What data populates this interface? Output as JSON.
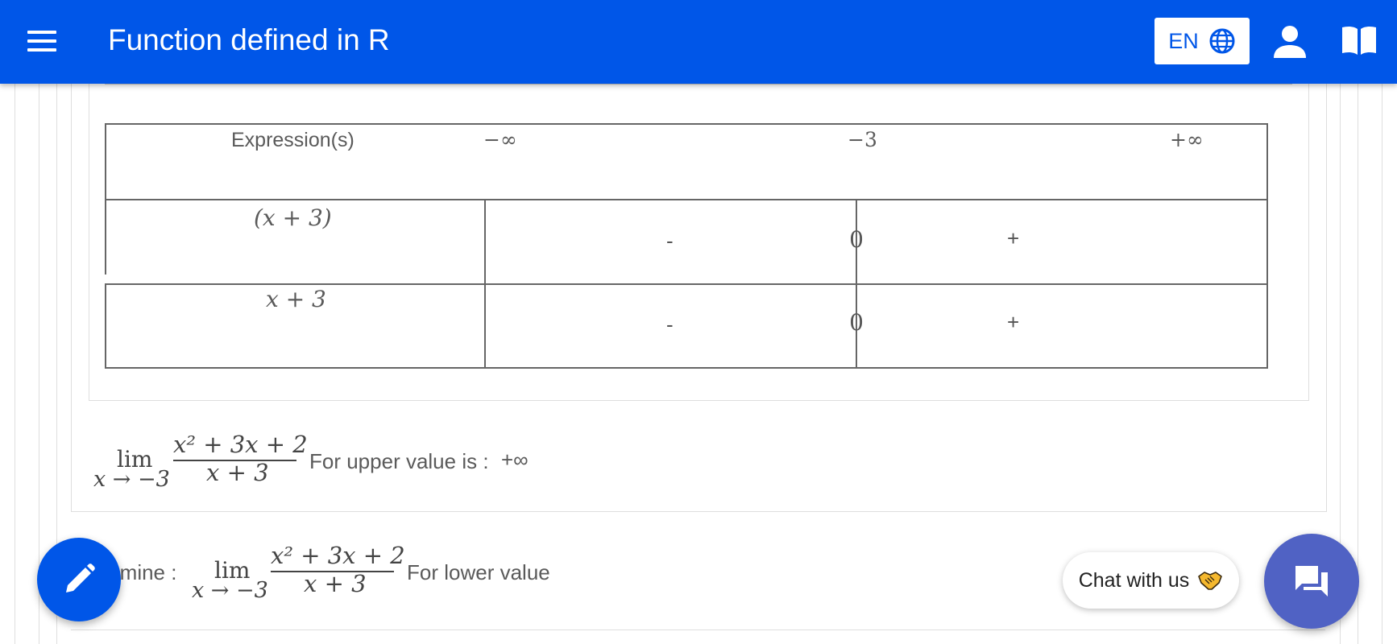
{
  "appbar": {
    "title": "Function defined in R",
    "language": "EN",
    "menu_icon": "hamburger-menu-icon",
    "globe_icon": "globe-icon",
    "user_icon": "user-icon",
    "book_icon": "book-open-icon",
    "color": "#0056e8"
  },
  "sign_table": {
    "header": {
      "label": "Expression(s)",
      "points": [
        "−∞",
        "−3",
        "+∞"
      ]
    },
    "rows": [
      {
        "expression": "(x + 3)",
        "left_sign": "-",
        "zero": "0",
        "right_sign": "+"
      },
      {
        "expression": "x + 3",
        "left_sign": "-",
        "zero": "0",
        "right_sign": "+"
      }
    ]
  },
  "limit_upper": {
    "lim": "lim",
    "subscript": "x → −3",
    "numerator": "x² + 3x + 2",
    "denominator": "x + 3",
    "text": "For upper value is :",
    "value": "+∞"
  },
  "limit_lower": {
    "prefix": "rmine :",
    "lim": "lim",
    "subscript": "x → −3",
    "numerator": "x² + 3x + 2",
    "denominator": "x + 3",
    "text": "For lower value"
  },
  "fab": {
    "edit_icon": "pencil-icon",
    "chat_label": "Chat with us",
    "handshake_icon": "handshake-icon",
    "chat_icon": "chat-bubbles-icon",
    "chat_color": "#5062c4"
  }
}
